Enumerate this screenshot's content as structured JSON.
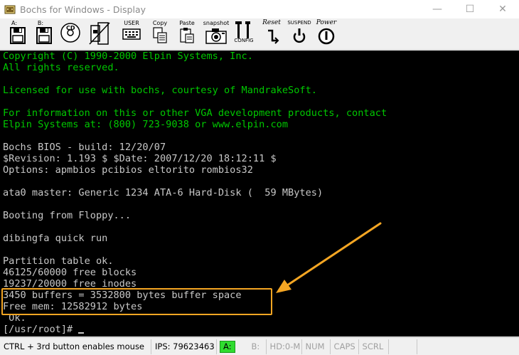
{
  "window": {
    "title": "Bochs for Windows - Display",
    "minimize_glyph": "—",
    "maximize_glyph": "☐",
    "close_glyph": "✕"
  },
  "toolbar": {
    "floppy_a_label": "A:",
    "floppy_b_label": "B:",
    "cdrom_label": "CD",
    "user_label": "USER",
    "copy_label": "Copy",
    "paste_label": "Paste",
    "snapshot_label": "snapshot",
    "config_label": "CONFIG",
    "reset_label": "Reset",
    "suspend_label": "SUSPEND",
    "power_label": "Power"
  },
  "screen": {
    "lines": [
      {
        "text": "Copyright (C) 1990-2000 Elpin Systems, Inc.",
        "color": "green"
      },
      {
        "text": "All rights reserved.",
        "color": "green"
      },
      {
        "text": "",
        "color": "green"
      },
      {
        "text": "Licensed for use with bochs, courtesy of MandrakeSoft.",
        "color": "green"
      },
      {
        "text": "",
        "color": "green"
      },
      {
        "text": "For information on this or other VGA development products, contact",
        "color": "green"
      },
      {
        "text": "Elpin Systems at: (800) 723-9038 or www.elpin.com",
        "color": "green"
      },
      {
        "text": "",
        "color": "white"
      },
      {
        "text": "Bochs BIOS - build: 12/20/07",
        "color": "white"
      },
      {
        "text": "$Revision: 1.193 $ $Date: 2007/12/20 18:12:11 $",
        "color": "white"
      },
      {
        "text": "Options: apmbios pcibios eltorito rombios32",
        "color": "white"
      },
      {
        "text": "",
        "color": "white"
      },
      {
        "text": "ata0 master: Generic 1234 ATA-6 Hard-Disk (  59 MBytes)",
        "color": "white"
      },
      {
        "text": "",
        "color": "white"
      },
      {
        "text": "Booting from Floppy...",
        "color": "white"
      },
      {
        "text": "",
        "color": "white"
      },
      {
        "text": "dibingfa quick run",
        "color": "white"
      },
      {
        "text": "",
        "color": "white"
      },
      {
        "text": "Partition table ok.",
        "color": "white"
      },
      {
        "text": "46125/60000 free blocks",
        "color": "white"
      },
      {
        "text": "19237/20000 free inodes",
        "color": "white"
      },
      {
        "text": "3450 buffers = 3532800 bytes buffer space",
        "color": "white"
      },
      {
        "text": "Free mem: 12582912 bytes",
        "color": "white"
      },
      {
        "text": " Ok.",
        "color": "white"
      },
      {
        "text": "[/usr/root]# ",
        "color": "white",
        "cursor": true
      }
    ]
  },
  "status": {
    "mouse_hint": "CTRL + 3rd button enables mouse",
    "ips": "IPS:  79623463",
    "drive_a": "A:",
    "drive_b": "B:",
    "hd": "HD:0-M",
    "num": "NUM",
    "caps": "CAPS",
    "scrl": "SCRL"
  },
  "colors": {
    "terminal_green": "#00c800",
    "terminal_white": "#c8c8c8",
    "highlight_orange": "#f5a623"
  }
}
